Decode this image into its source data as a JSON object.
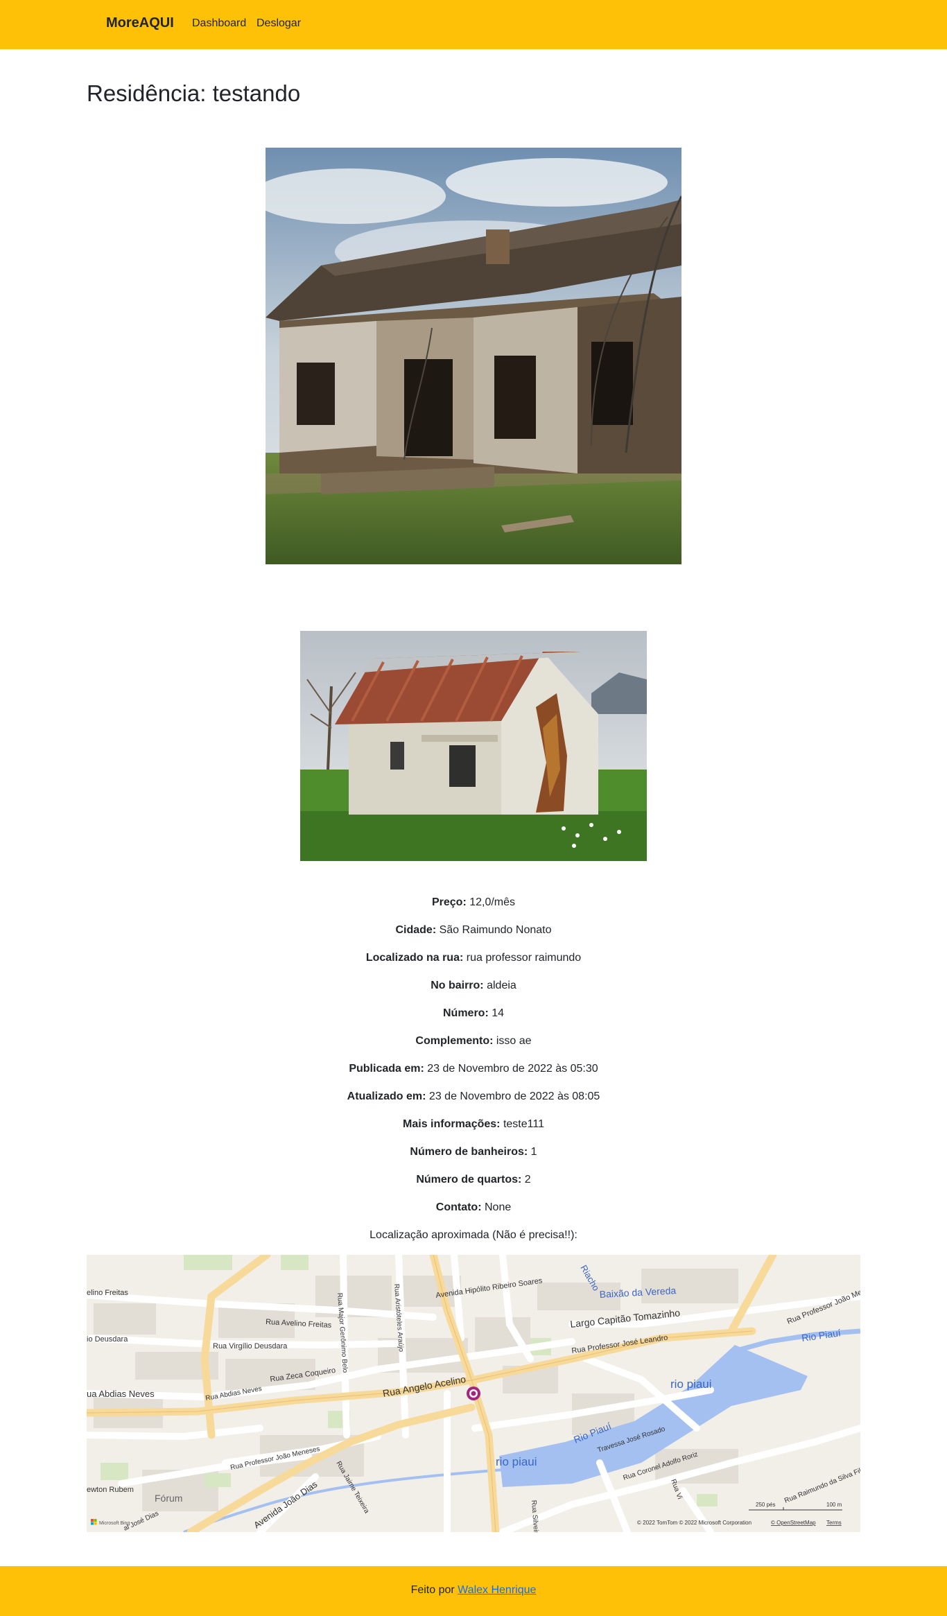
{
  "navbar": {
    "brand": "MoreAQUI",
    "links": [
      "Dashboard",
      "Deslogar"
    ]
  },
  "page": {
    "title": "Residência: testando"
  },
  "details": [
    {
      "label": "Preço:",
      "value": "12,0/mês"
    },
    {
      "label": "Cidade:",
      "value": "São Raimundo Nonato"
    },
    {
      "label": "Localizado na rua:",
      "value": "rua professor raimundo"
    },
    {
      "label": "No bairro:",
      "value": "aldeia"
    },
    {
      "label": "Número:",
      "value": "14"
    },
    {
      "label": "Complemento:",
      "value": "isso ae"
    },
    {
      "label": "Publicada em:",
      "value": "23 de Novembro de 2022 às 05:30"
    },
    {
      "label": "Atualizado em:",
      "value": "23 de Novembro de 2022 às 08:05"
    },
    {
      "label": "Mais informações:",
      "value": "teste111"
    },
    {
      "label": "Número de banheiros:",
      "value": "1"
    },
    {
      "label": "Número de quartos:",
      "value": "2"
    },
    {
      "label": "Contato:",
      "value": "None"
    }
  ],
  "map": {
    "caption": "Localização aproximada (Não é precisa!!):",
    "labels": {
      "avelino_freitas_w": "elino Freitas",
      "avelino_freitas": "Rua Avelino Freitas",
      "deusdara_w": "io Deusdara",
      "virgilio_deusdara": "Rua Virgílio Deusdara",
      "abdias_neves_w": "ua Abdias Neves",
      "abdias_neves": "Rua Abdias Neves",
      "zeca_coqueiro": "Rua Zeca Coqueiro",
      "angelo_acelino": "Rua Angelo Acelino",
      "major_geronimo": "Rua Major Gerônimo Belo",
      "aristoteles": "Rua Aristóteles Araújo",
      "hipolito": "Avenida Hipólito Ribeiro Soares",
      "riacho": "Riacho",
      "baixao": "Baixão da Vereda",
      "largo": "Largo Capitão Tomazinho",
      "jose_leandro": "Rua Professor José Leandro",
      "joao_me": "Rua Professor João Me",
      "rio_piaui_e": "Rio Piauí",
      "rio_piaui_1": "rio piaui",
      "rio_piaui_2": "Rio Piauí",
      "rio_piaui_3": "rio piaui",
      "travessa": "Travessa José Rosado",
      "coronel": "Rua Coronel Adolfo Roriz",
      "joao_meneses": "Rua Professor João Meneses",
      "jaime_teixeira": "Rua Jaime Teixeira",
      "joao_dias": "Avenida João Dias",
      "forum": "Fórum",
      "newton": "ewton Rubem",
      "jose_dias": "al José Dias",
      "raimundo_silva": "Rua Raimundo da Silva Filho",
      "silveira": "Rua Silveira",
      "rua_v": "Rua Vi",
      "scale_ft": "250 pés",
      "scale_m": "100 m",
      "copyright": "© 2022 TomTom © 2022 Microsoft Corporation",
      "osm": "© OpenStreetMap",
      "terms": "Terms",
      "bing": "Microsoft Bing"
    }
  },
  "footer": {
    "prefix": "Feito por",
    "author": "Walex Henrique"
  },
  "colors": {
    "accent": "#ffc107",
    "link": "#0d6efd",
    "water": "#a3c0f0",
    "pin": "#a2267e"
  }
}
